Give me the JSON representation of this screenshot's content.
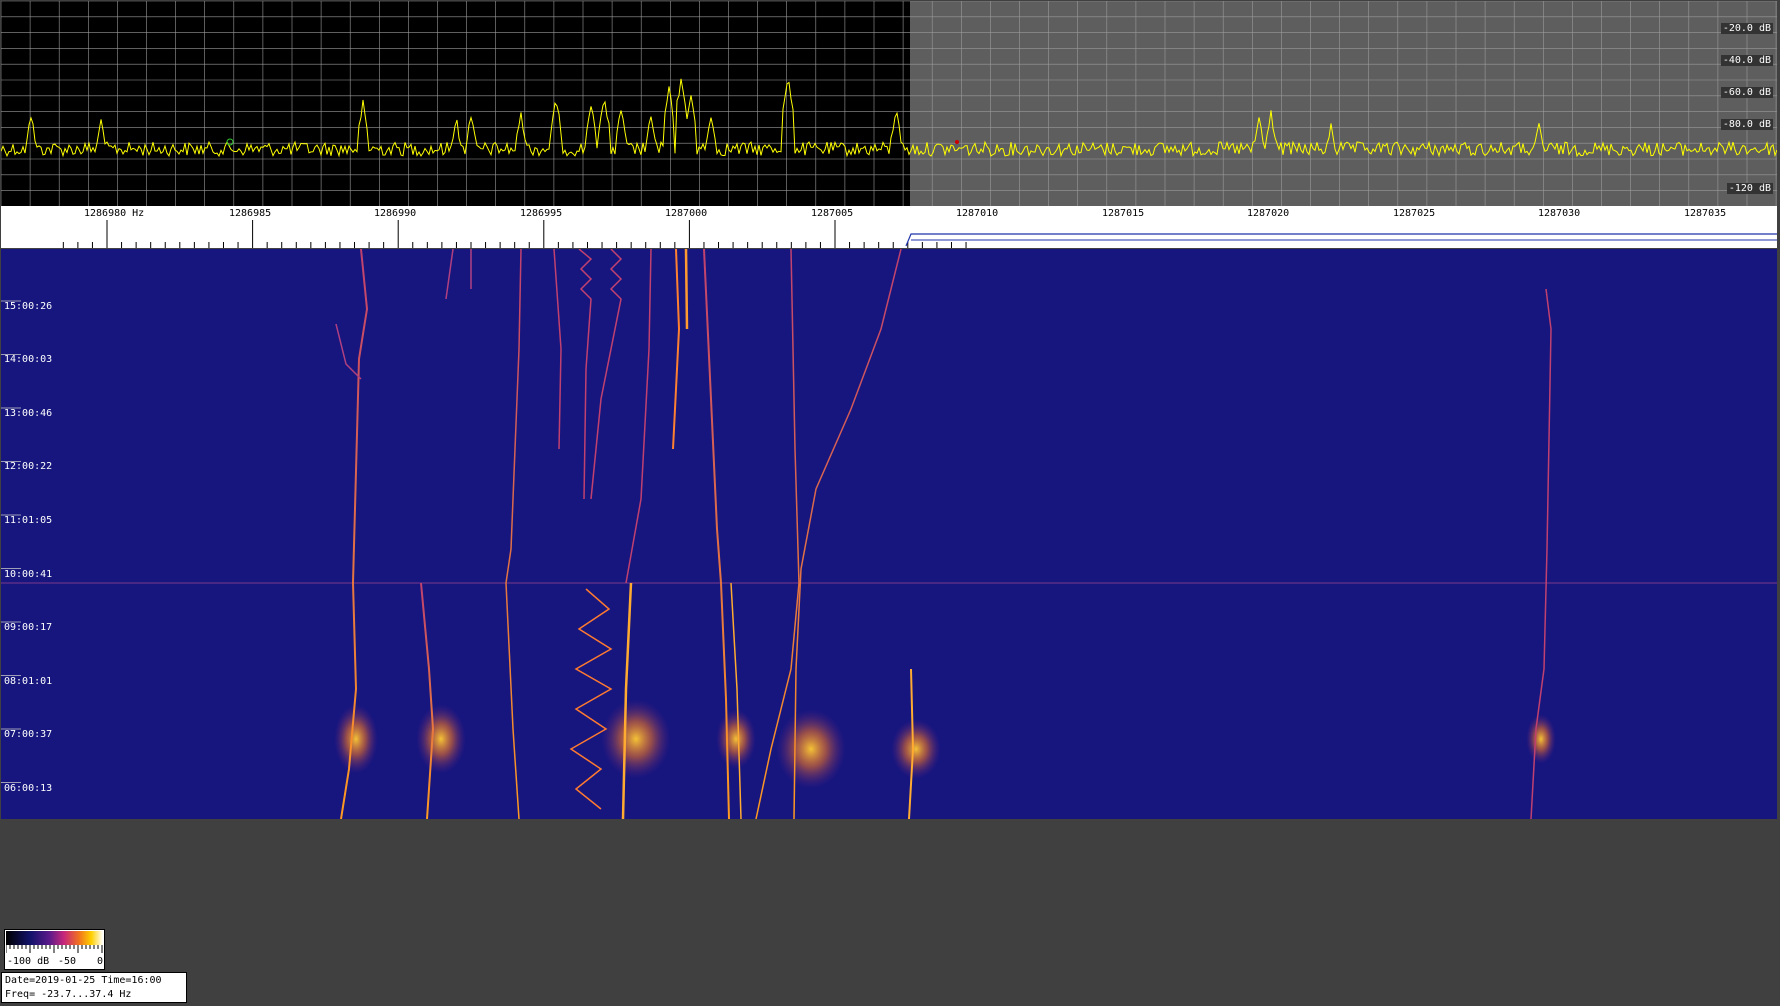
{
  "spectrum": {
    "db_labels": [
      "-20.0 dB",
      "-40.0 dB",
      "-60.0 dB",
      "-80.0 dB",
      "-120 dB"
    ],
    "trace_color": "#ffff00",
    "grid_color": "#aaaaaa",
    "left_background": "#000000",
    "right_background": "#606060"
  },
  "ruler": {
    "freq_labels": [
      "1286980 Hz",
      "1286985",
      "1286990",
      "1286995",
      "1287000",
      "1287005",
      "1287010",
      "1287015",
      "1287020",
      "1287025",
      "1287030",
      "1287035"
    ]
  },
  "waterfall": {
    "background": "#14147a",
    "time_labels": [
      "15:00:26",
      "14:00:03",
      "13:00:46",
      "12:00:22",
      "11:01:05",
      "10:00:41",
      "09:00:17",
      "08:01:01",
      "07:00:37",
      "06:00:13"
    ]
  },
  "colorbar": {
    "labels": [
      "-100 dB",
      "-50",
      "0"
    ]
  },
  "info": {
    "date_line": "Date=2019-01-25 Time=16:00",
    "freq_line": "Freq= -23.7...37.4 Hz"
  }
}
